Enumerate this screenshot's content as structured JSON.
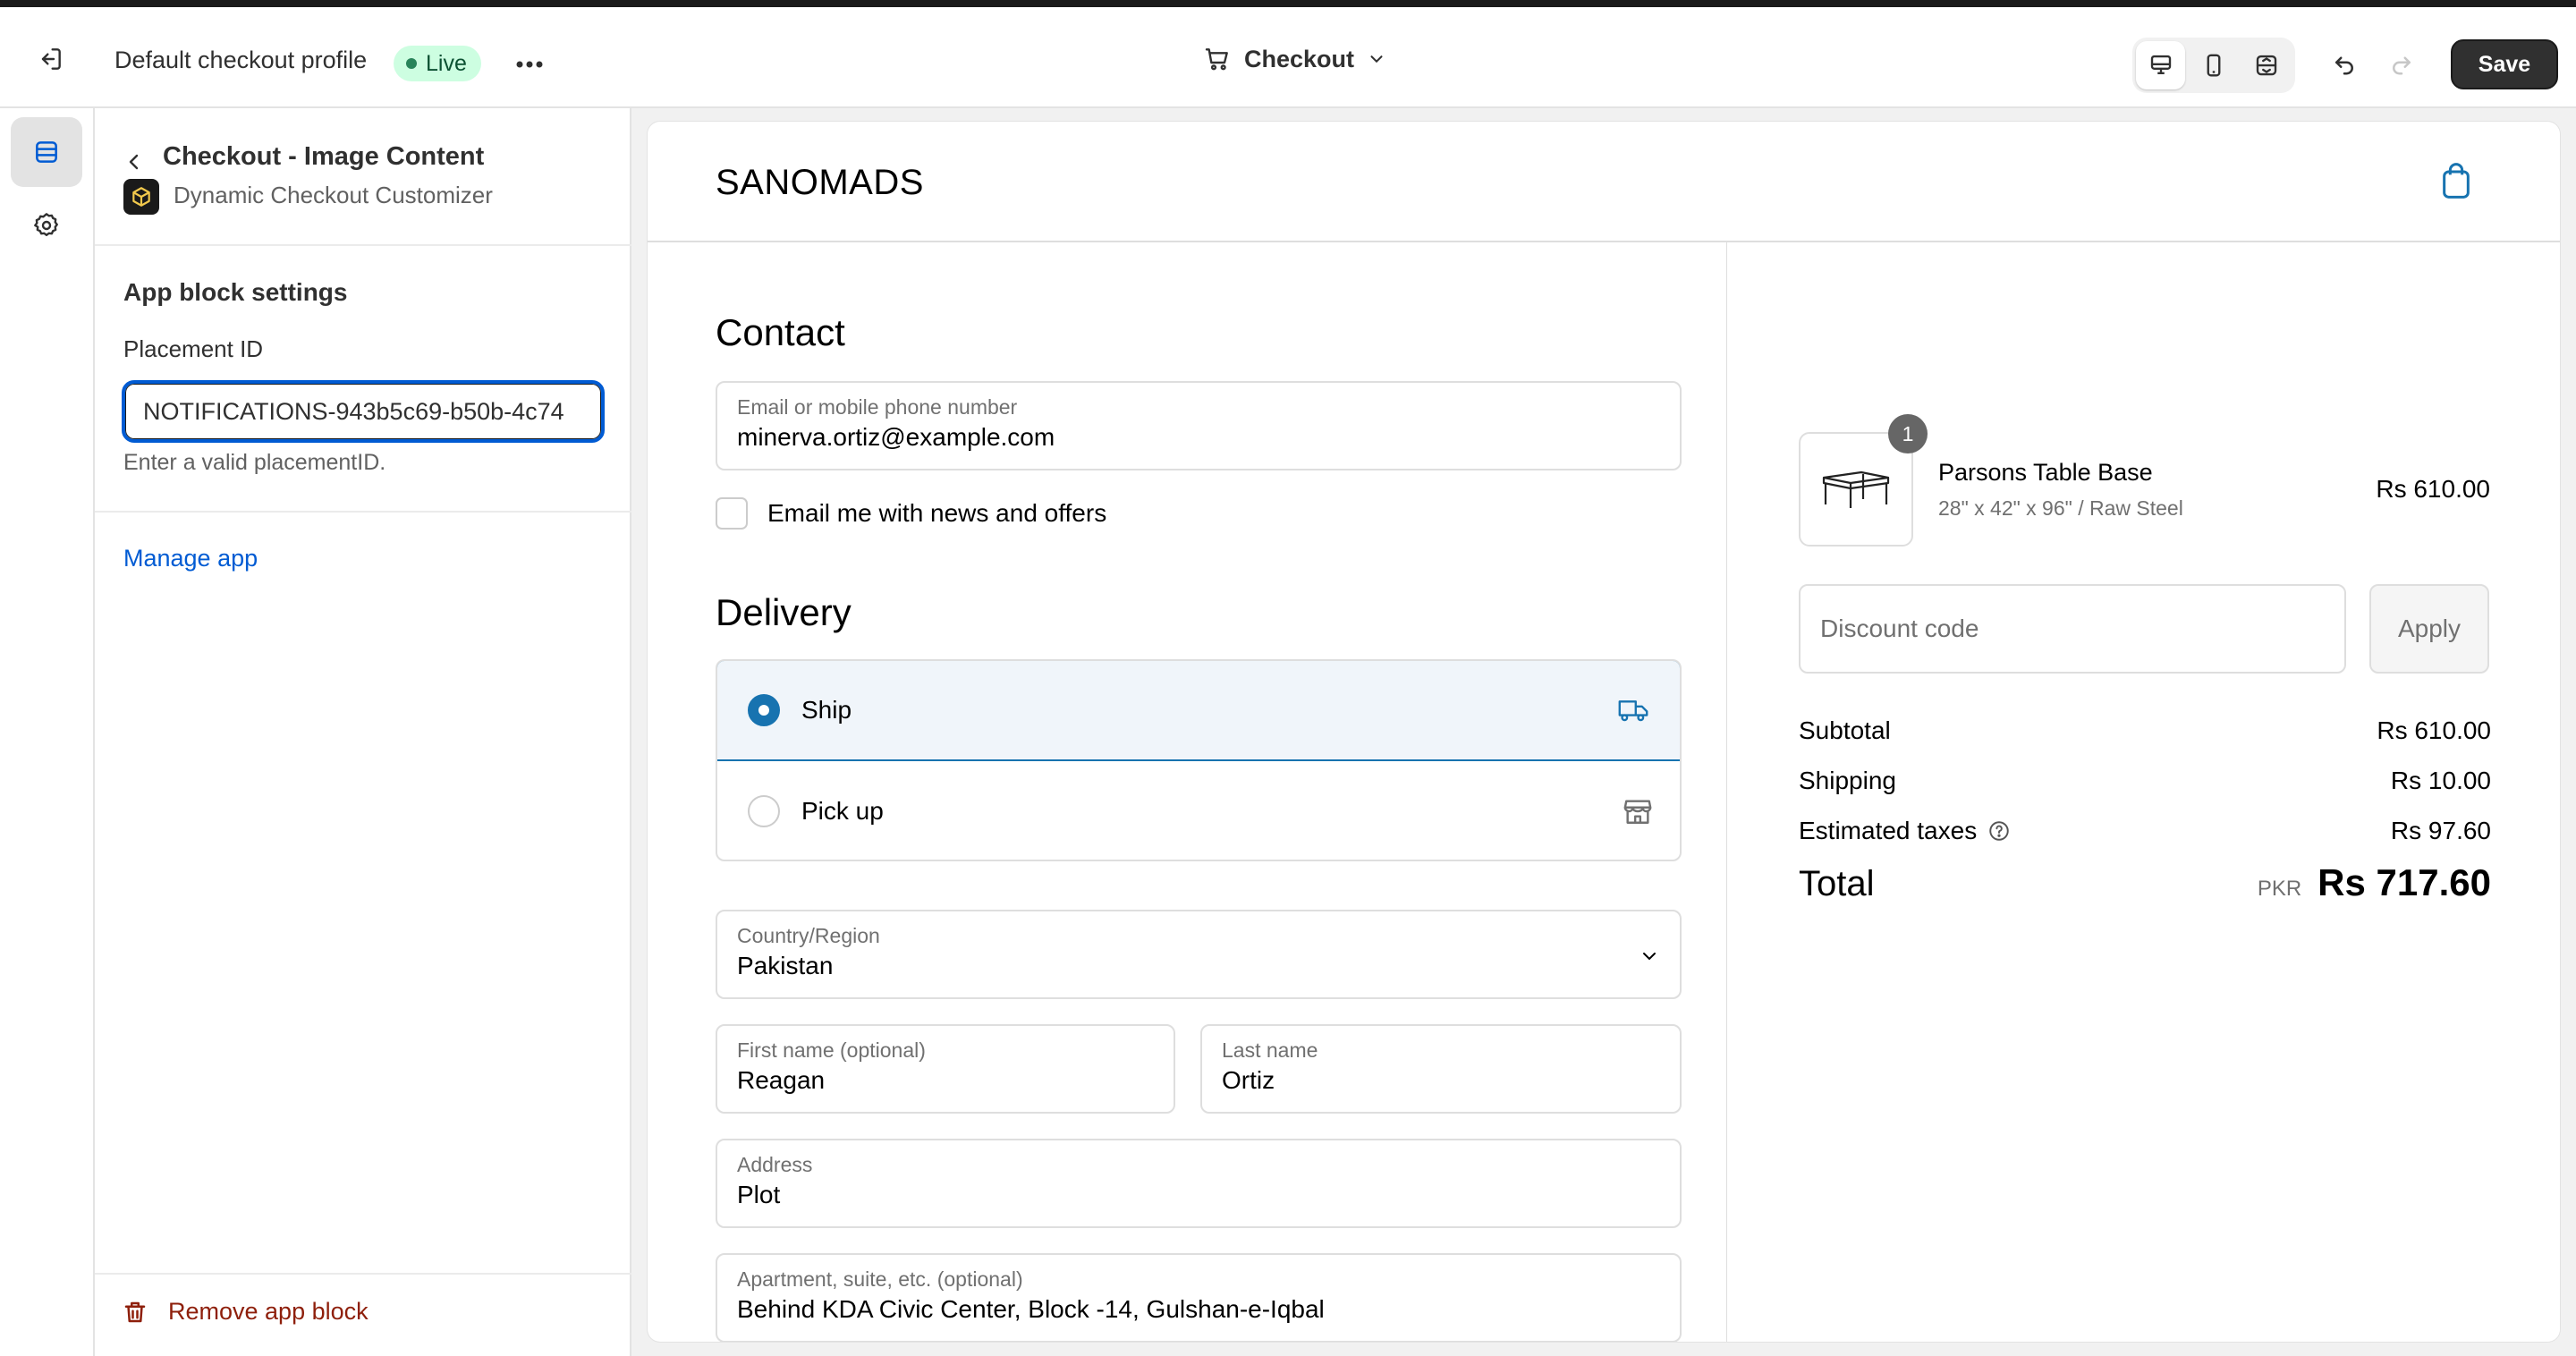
{
  "topbar": {
    "profile_title": "Default checkout profile",
    "status_badge": "Live",
    "page_selector": "Checkout",
    "save_label": "Save"
  },
  "panel": {
    "title": "Checkout - Image Content",
    "app_name": "Dynamic Checkout Customizer",
    "section_title": "App block settings",
    "placement_label": "Placement ID",
    "placement_value": "NOTIFICATIONS-943b5c69-b50b-4c74",
    "placement_help": "Enter a valid placementID.",
    "manage_link": "Manage app",
    "remove_label": "Remove app block"
  },
  "checkout": {
    "brand": "SANOMADS",
    "contact": {
      "heading": "Contact",
      "email_label": "Email or mobile phone number",
      "email_value": "minerva.ortiz@example.com",
      "newsletter_label": "Email me with news and offers"
    },
    "delivery": {
      "heading": "Delivery",
      "options": [
        {
          "label": "Ship",
          "selected": true
        },
        {
          "label": "Pick up",
          "selected": false
        }
      ],
      "country_label": "Country/Region",
      "country_value": "Pakistan",
      "first_name_label": "First name (optional)",
      "first_name_value": "Reagan",
      "last_name_label": "Last name",
      "last_name_value": "Ortiz",
      "address_label": "Address",
      "address_value": "Plot",
      "apartment_label": "Apartment, suite, etc. (optional)",
      "apartment_value": "Behind KDA Civic Center, Block -14, Gulshan-e-Iqbal"
    },
    "summary": {
      "quantity": "1",
      "product_name": "Parsons Table Base",
      "product_variant": "28\" x 42\" x 96\" / Raw Steel",
      "product_price": "Rs 610.00",
      "discount_placeholder": "Discount code",
      "apply_label": "Apply",
      "subtotal_label": "Subtotal",
      "subtotal_value": "Rs 610.00",
      "shipping_label": "Shipping",
      "shipping_value": "Rs 10.00",
      "taxes_label": "Estimated taxes",
      "taxes_value": "Rs 97.60",
      "total_label": "Total",
      "currency": "PKR",
      "total_value": "Rs 717.60"
    }
  },
  "colors": {
    "accent": "#1773b0",
    "admin_link": "#005bd3",
    "live_badge_bg": "#cdfee1",
    "danger": "#8e1f0b"
  }
}
